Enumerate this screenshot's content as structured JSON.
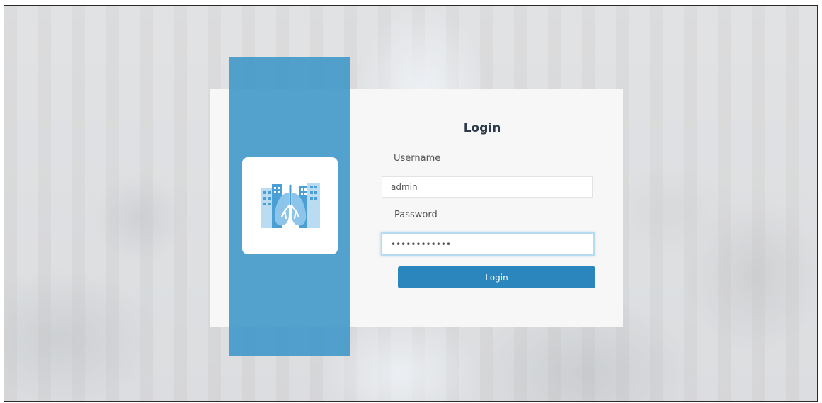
{
  "login": {
    "title": "Login",
    "username_label": "Username",
    "username_value": "admin",
    "password_label": "Password",
    "password_value": "••••••••••••",
    "button_label": "Login"
  },
  "icons": {
    "logo": "city-lungs-icon"
  },
  "colors": {
    "accent": "#2b86bd",
    "panel": "#3c96c8",
    "logo_blue": "#4a9fd6",
    "logo_light": "#b9dcf3"
  }
}
